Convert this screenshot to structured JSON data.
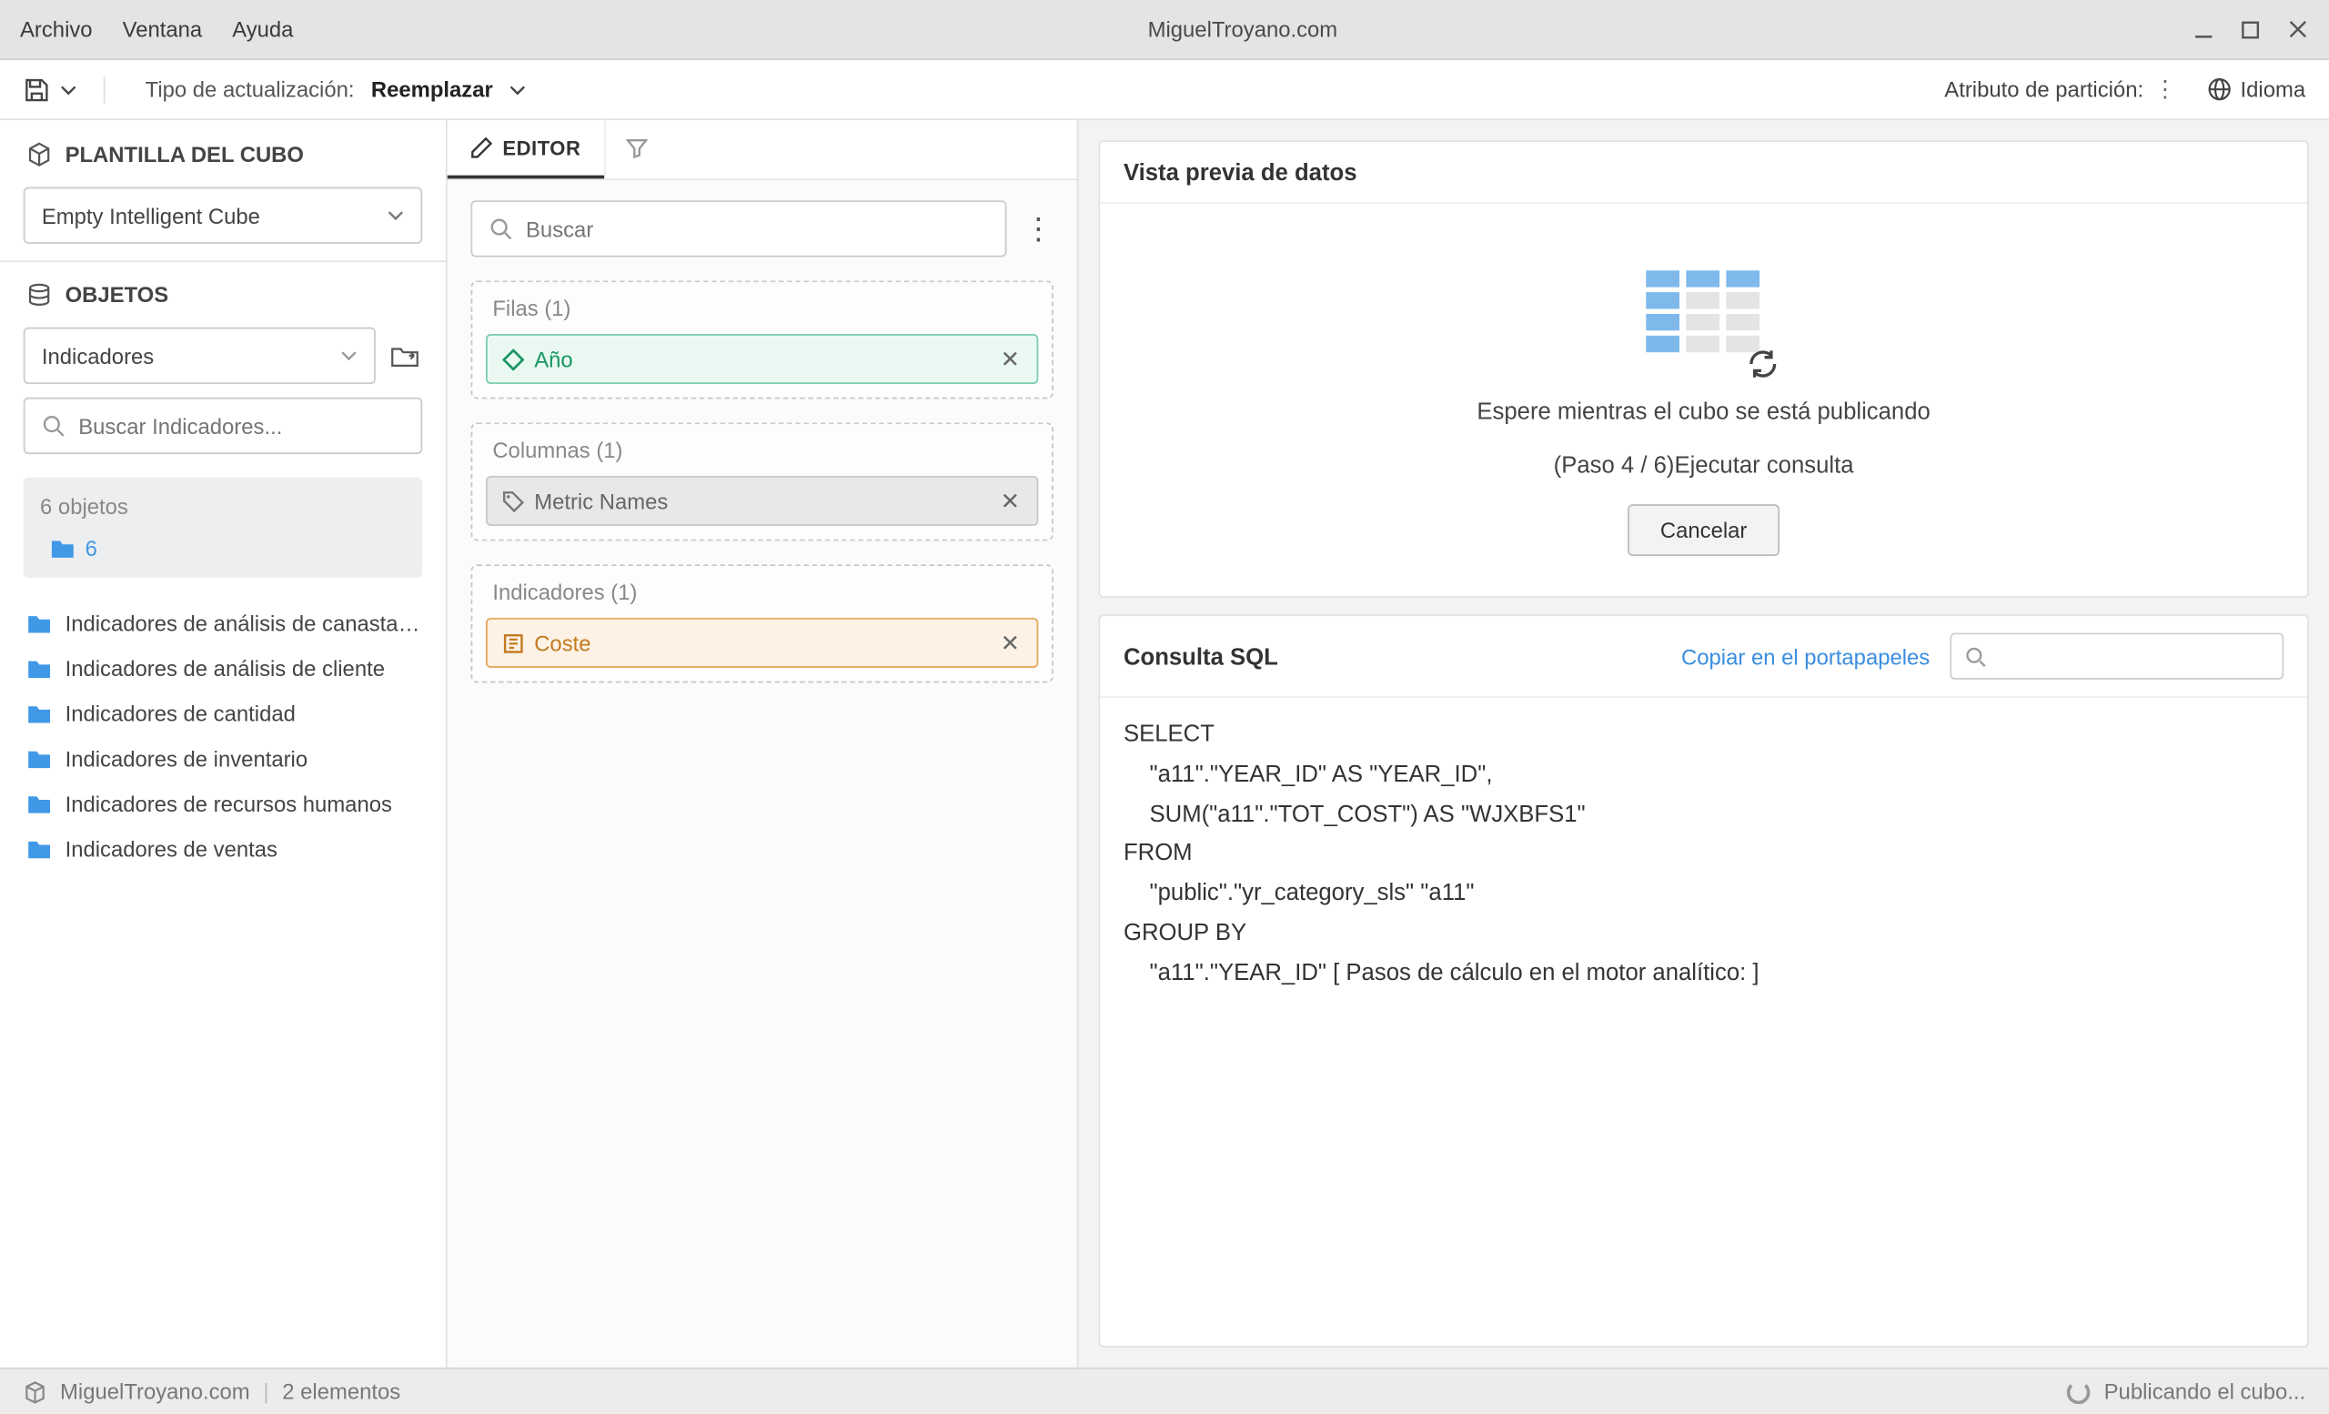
{
  "titlebar": {
    "menu": {
      "file": "Archivo",
      "window": "Ventana",
      "help": "Ayuda"
    },
    "title": "MiguelTroyano.com"
  },
  "toolbar": {
    "update_type_label": "Tipo de actualización:",
    "update_type_value": "Reemplazar",
    "partition_attr_label": "Atributo de partición:",
    "language_label": "Idioma"
  },
  "left": {
    "template_header": "PLANTILLA DEL CUBO",
    "cube_select": "Empty Intelligent Cube",
    "objects_header": "OBJETOS",
    "category_select": "Indicadores",
    "search_placeholder": "Buscar Indicadores...",
    "count_label": "6 objetos",
    "six_link": "6",
    "folders": [
      "Indicadores de análisis de canasta…",
      "Indicadores de análisis de cliente",
      "Indicadores de cantidad",
      "Indicadores de inventario",
      "Indicadores de recursos humanos",
      "Indicadores de ventas"
    ]
  },
  "center": {
    "tab_editor": "EDITOR",
    "search_placeholder": "Buscar",
    "rows": {
      "label": "Filas (1)",
      "pill": "Año"
    },
    "cols": {
      "label": "Columnas (1)",
      "pill": "Metric Names"
    },
    "inds": {
      "label": "Indicadores (1)",
      "pill": "Coste"
    }
  },
  "right": {
    "preview_title": "Vista previa de datos",
    "wait_text": "Espere mientras el cubo se está publicando",
    "step_text": "(Paso 4 / 6)Ejecutar consulta",
    "cancel": "Cancelar",
    "sql_title": "Consulta SQL",
    "copy_link": "Copiar en el portapapeles",
    "sql_body": "SELECT\n    \"a11\".\"YEAR_ID\" AS \"YEAR_ID\",\n    SUM(\"a11\".\"TOT_COST\") AS \"WJXBFS1\"\nFROM\n    \"public\".\"yr_category_sls\" \"a11\"\nGROUP BY\n    \"a11\".\"YEAR_ID\" [ Pasos de cálculo en el motor analítico: ]"
  },
  "status": {
    "site": "MiguelTroyano.com",
    "elements": "2 elementos",
    "publishing": "Publicando el cubo..."
  }
}
